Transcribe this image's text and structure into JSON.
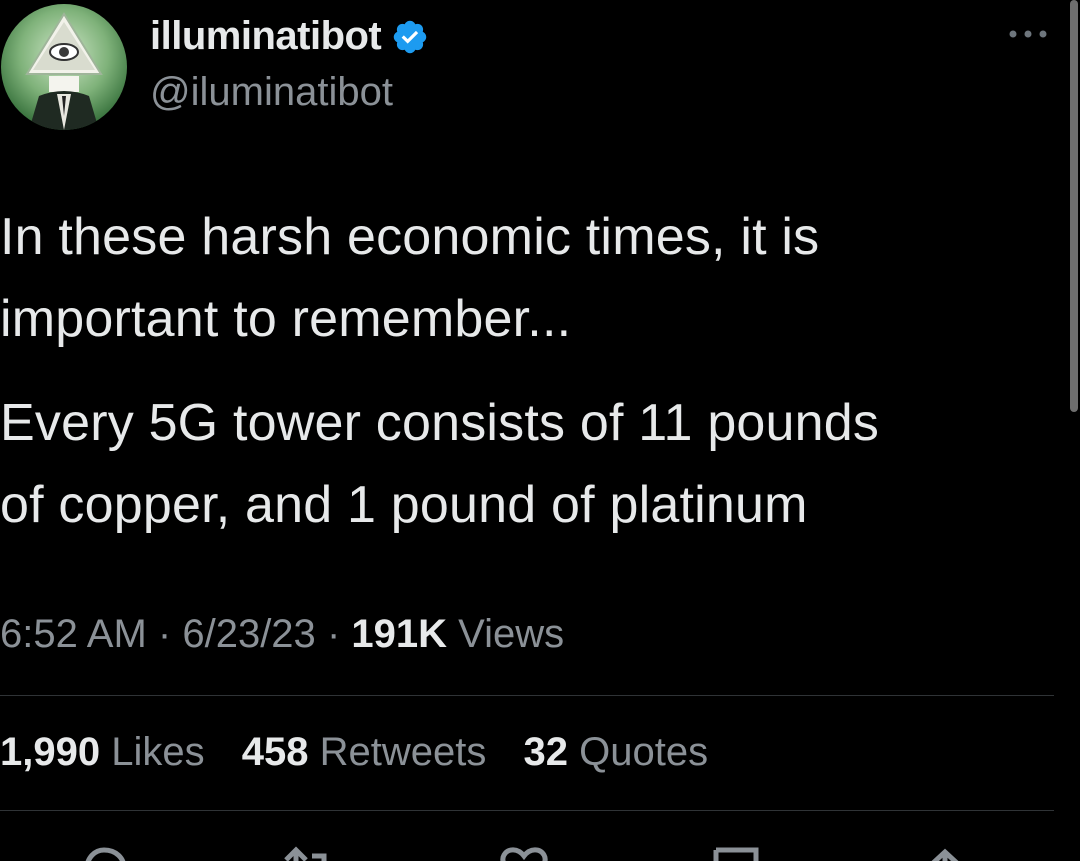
{
  "author": {
    "display_name": "illuminatibot",
    "handle": "@iluminatibot",
    "verified_icon": "verified-badge-icon",
    "avatar_icon": "illuminati-eye-pyramid-avatar"
  },
  "tweet": {
    "paragraphs": [
      "In these harsh economic times, it is\nimportant to remember...",
      "Every 5G tower consists of 11 pounds\nof copper, and 1 pound of platinum"
    ]
  },
  "meta": {
    "time": "6:52 AM",
    "date": "6/23/23",
    "views_count": "191K",
    "views_label": "Views",
    "separator": "·"
  },
  "stats": {
    "likes_count": "1,990",
    "likes_label": "Likes",
    "retweets_count": "458",
    "retweets_label": "Retweets",
    "quotes_count": "32",
    "quotes_label": "Quotes"
  },
  "icons": {
    "more": "more-options-icon",
    "reply": "reply-icon",
    "retweet": "retweet-icon",
    "like": "like-icon",
    "bookmark": "bookmark-icon",
    "share": "share-icon"
  },
  "colors": {
    "background": "#000000",
    "text": "#e7e9ea",
    "secondary_text": "#8b9197",
    "verified": "#1d9bf0",
    "divider": "#2f3336"
  }
}
